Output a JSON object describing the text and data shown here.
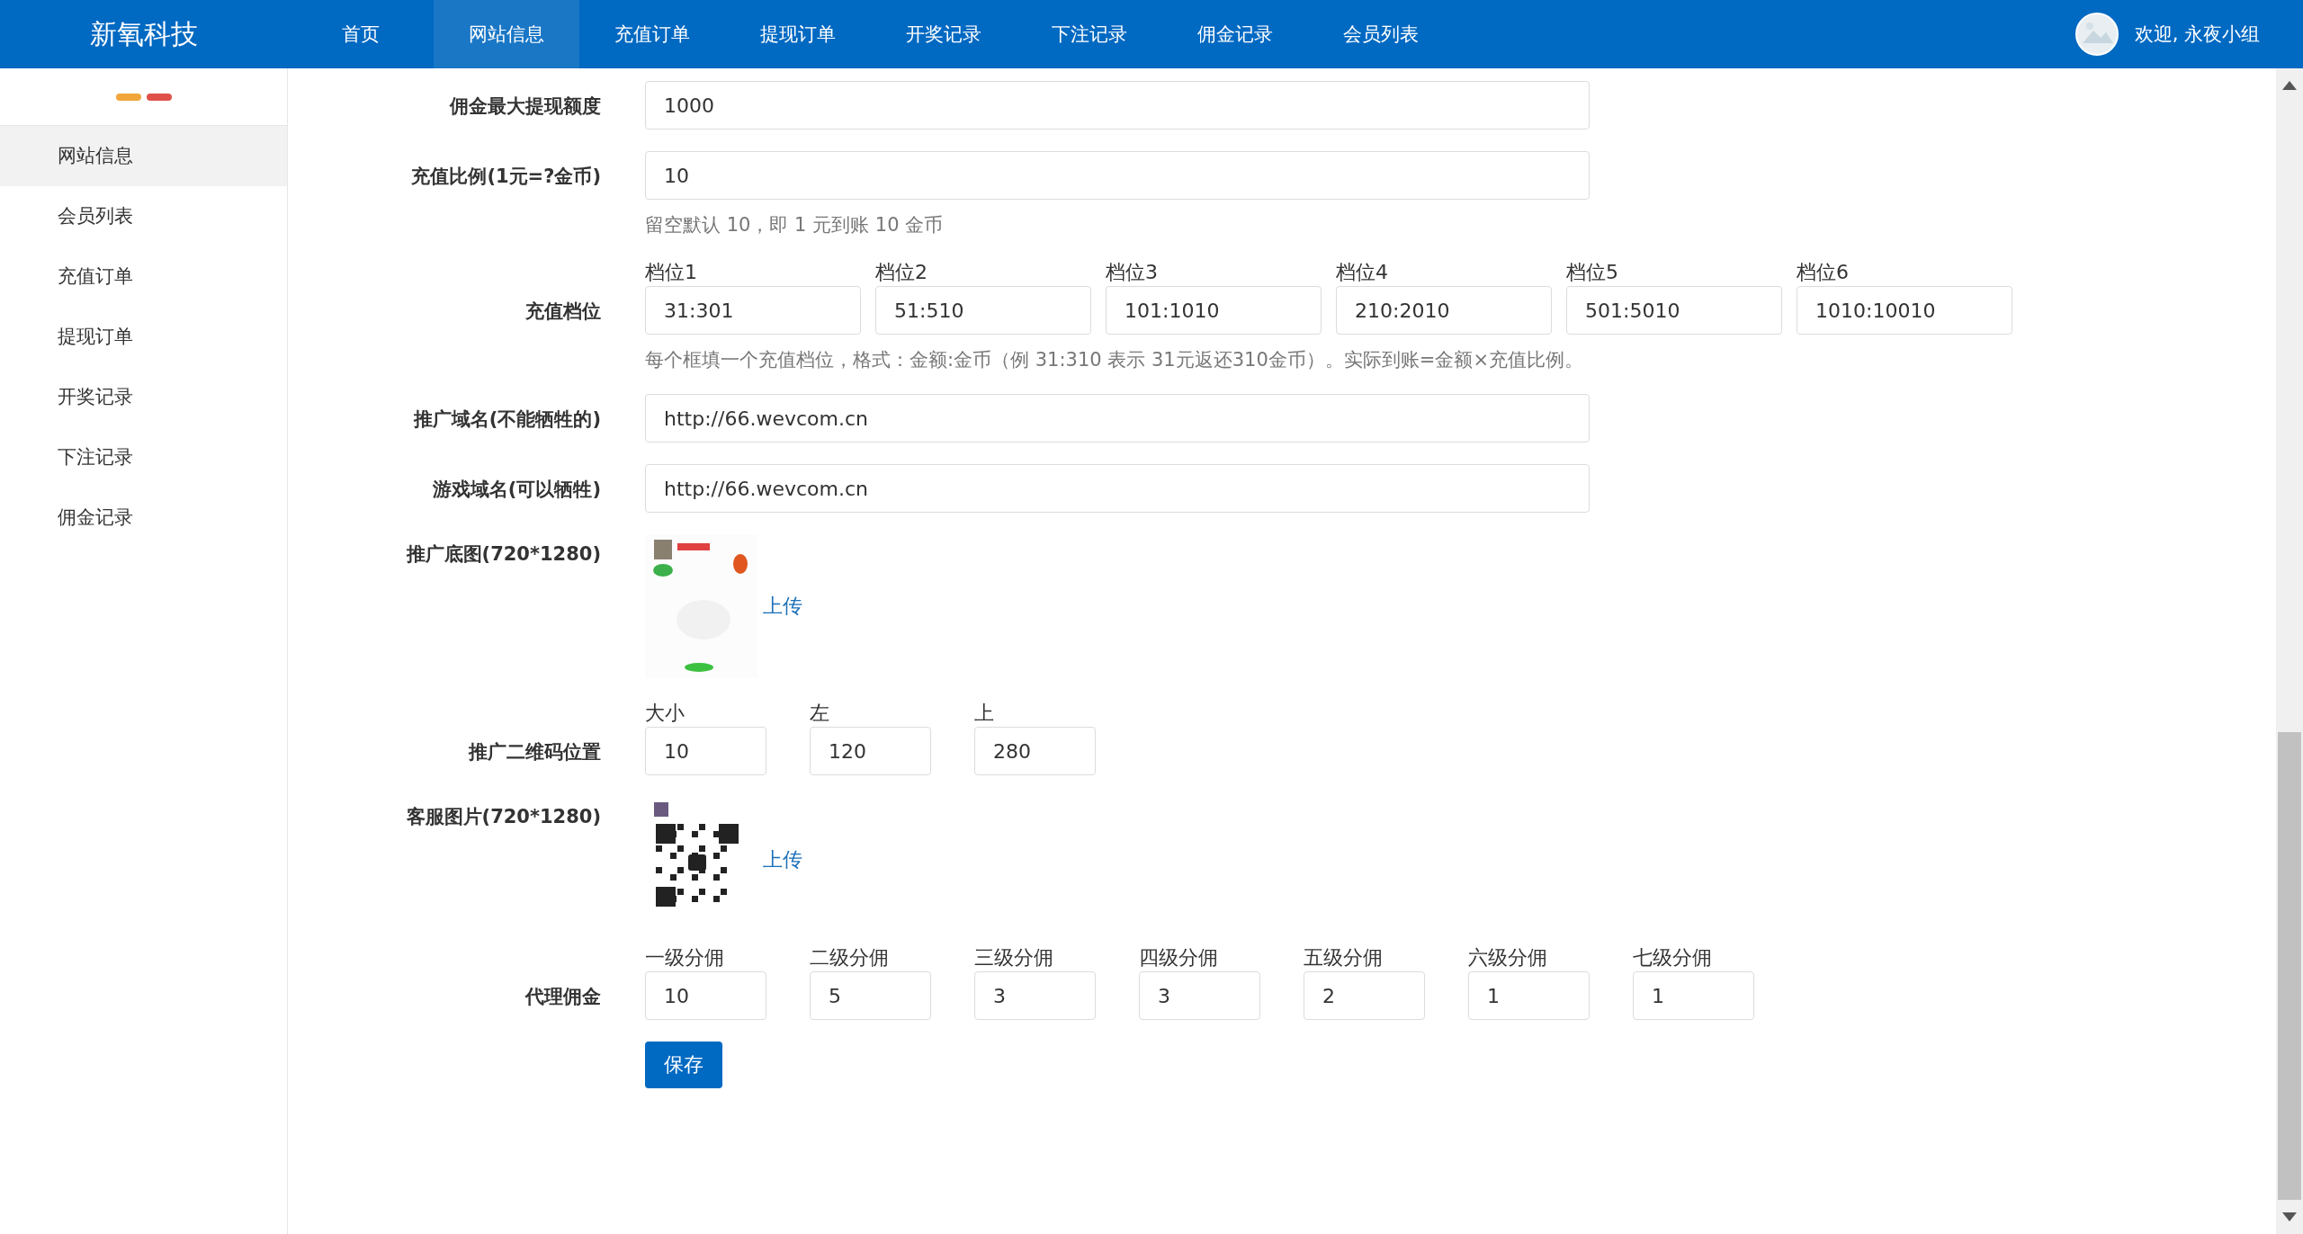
{
  "header": {
    "logo": "新氧科技",
    "nav": [
      {
        "label": "首页",
        "selected": false
      },
      {
        "label": "网站信息",
        "selected": true
      },
      {
        "label": "充值订单",
        "selected": false
      },
      {
        "label": "提现订单",
        "selected": false
      },
      {
        "label": "开奖记录",
        "selected": false
      },
      {
        "label": "下注记录",
        "selected": false
      },
      {
        "label": "佣金记录",
        "selected": false
      },
      {
        "label": "会员列表",
        "selected": false
      }
    ],
    "greeting": "欢迎, 永夜小组"
  },
  "sidebar": {
    "items": [
      {
        "label": "网站信息",
        "selected": true
      },
      {
        "label": "会员列表",
        "selected": false
      },
      {
        "label": "充值订单",
        "selected": false
      },
      {
        "label": "提现订单",
        "selected": false
      },
      {
        "label": "开奖记录",
        "selected": false
      },
      {
        "label": "下注记录",
        "selected": false
      },
      {
        "label": "佣金记录",
        "selected": false
      }
    ]
  },
  "form": {
    "rows": [
      {
        "kind": "text",
        "label": "佣金最大提现额度",
        "value": "1000"
      },
      {
        "kind": "text",
        "label": "充值比例(1元=?金币)",
        "value": "10",
        "hint": "留空默认 10，即 1 元到账 10 金币"
      },
      {
        "kind": "wide_group",
        "label": "充值档位",
        "fields": [
          {
            "label": "档位1",
            "value": "31:301"
          },
          {
            "label": "档位2",
            "value": "51:510"
          },
          {
            "label": "档位3",
            "value": "101:1010"
          },
          {
            "label": "档位4",
            "value": "210:2010"
          },
          {
            "label": "档位5",
            "value": "501:5010"
          },
          {
            "label": "档位6",
            "value": "1010:10010"
          }
        ],
        "hint": "每个框填一个充值档位，格式：金额:金币（例 31:310 表示 31元返还310金币）。实际到账=金额×充值比例。"
      },
      {
        "kind": "text",
        "label": "推广域名(不能牺牲的)",
        "value": "http://66.wevcom.cn"
      },
      {
        "kind": "text",
        "label": "游戏域名(可以牺牲)",
        "value": "http://66.wevcom.cn"
      },
      {
        "label": "推广底图(720*1280)",
        "upload": "上传"
      },
      {
        "kind": "group",
        "label": "推广二维码位置",
        "fields": [
          {
            "label": "大小",
            "value": "10"
          },
          {
            "label": "左",
            "value": "120"
          },
          {
            "label": "上",
            "value": "280"
          }
        ]
      },
      {
        "label": "客服图片(720*1280)",
        "upload": "上传"
      },
      {
        "kind": "group",
        "label": "代理佣金",
        "fields": [
          {
            "label": "一级分佣",
            "value": "10"
          },
          {
            "label": "二级分佣",
            "value": "5"
          },
          {
            "label": "三级分佣",
            "value": "3"
          },
          {
            "label": "四级分佣",
            "value": "3"
          },
          {
            "label": "五级分佣",
            "value": "2"
          },
          {
            "label": "六级分佣",
            "value": "1"
          },
          {
            "label": "七级分佣",
            "value": "1"
          }
        ]
      }
    ],
    "save": "保存"
  }
}
